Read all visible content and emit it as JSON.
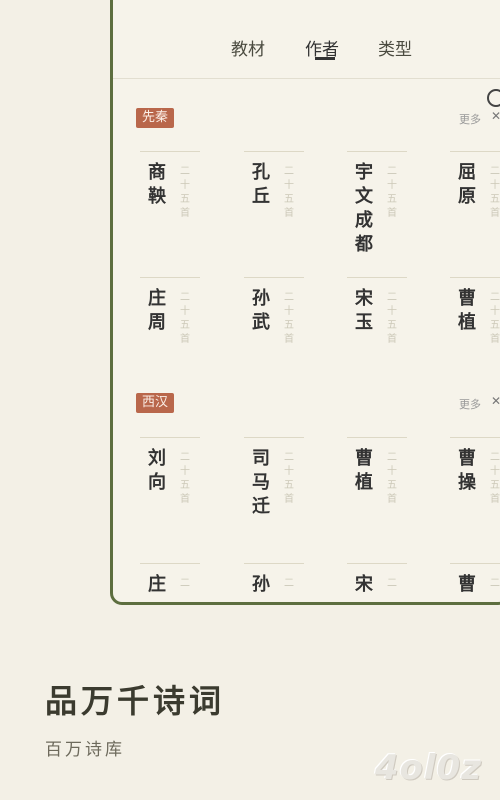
{
  "tabs": [
    "教材",
    "作者",
    "类型"
  ],
  "active_tab": 1,
  "sections": [
    {
      "tag": "先秦",
      "more": "更多",
      "authors": [
        {
          "name": "商鞅",
          "count": "二十五首"
        },
        {
          "name": "孔丘",
          "count": "二十五首"
        },
        {
          "name": "宇文成都",
          "count": "二十五首"
        },
        {
          "name": "屈原",
          "count": "二十五首"
        },
        {
          "name": "庄周",
          "count": "二十五首"
        },
        {
          "name": "孙武",
          "count": "二十五首"
        },
        {
          "name": "宋玉",
          "count": "二十五首"
        },
        {
          "name": "曹植",
          "count": "二十五首"
        }
      ]
    },
    {
      "tag": "西汉",
      "more": "更多",
      "authors": [
        {
          "name": "刘向",
          "count": "二十五首"
        },
        {
          "name": "司马迁",
          "count": "二十五首"
        },
        {
          "name": "曹植",
          "count": "二十五首"
        },
        {
          "name": "曹操",
          "count": "二十五首"
        },
        {
          "name": "庄",
          "count": "二"
        },
        {
          "name": "孙",
          "count": "二"
        },
        {
          "name": "宋",
          "count": "二"
        },
        {
          "name": "曹",
          "count": "二"
        }
      ]
    }
  ],
  "tagline": "品万千诗词",
  "subline": "百万诗库",
  "watermark": "4ol0z",
  "colors": {
    "tag_bg": "#b9674b",
    "frame": "#5d6e3f",
    "background": "#f3f0e6"
  }
}
